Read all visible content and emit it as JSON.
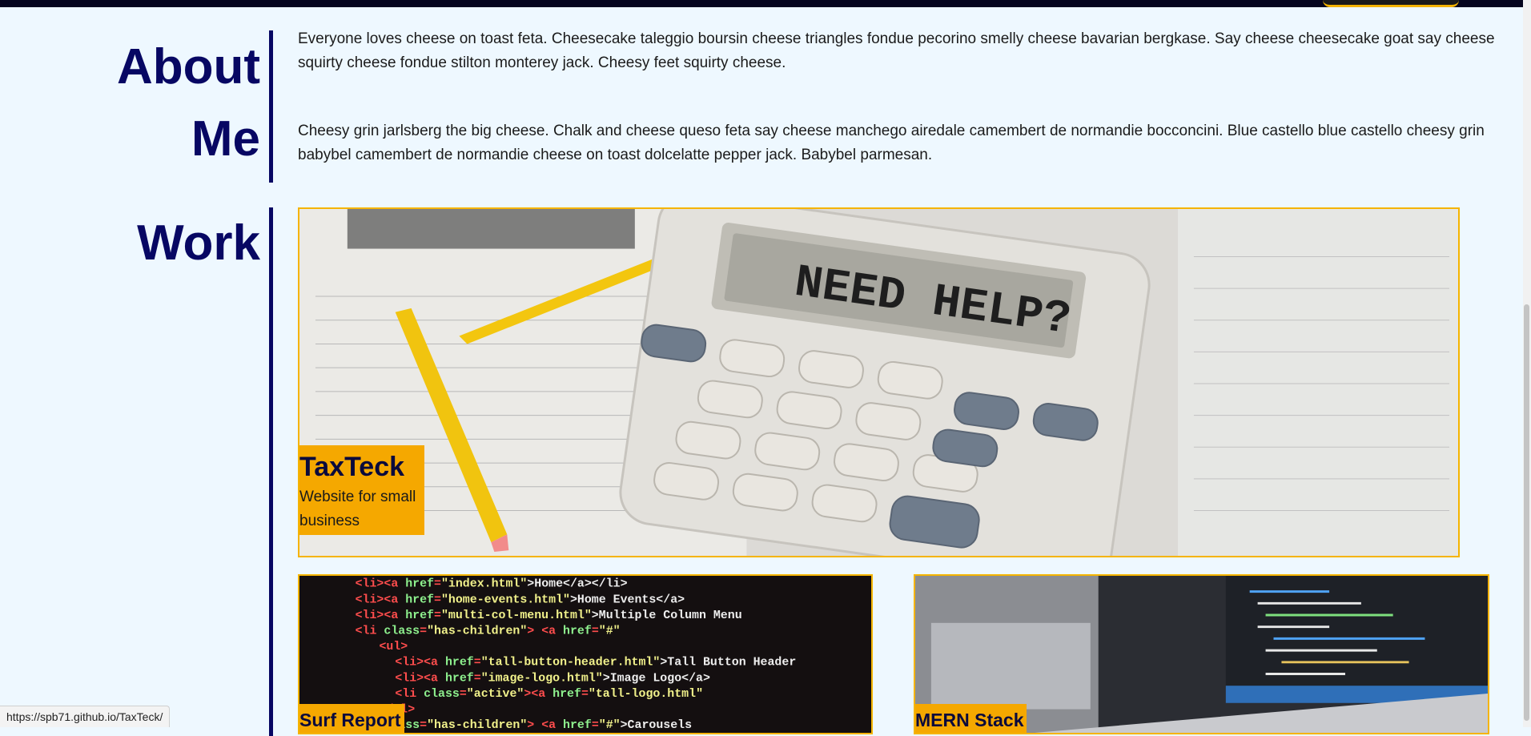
{
  "about": {
    "title": "About Me",
    "paragraphs": [
      "Everyone loves cheese on toast feta. Cheesecake taleggio boursin cheese triangles fondue pecorino smelly cheese bavarian bergkase. Say cheese cheesecake goat say cheese squirty cheese fondue stilton monterey jack. Cheesy feet squirty cheese.",
      "Cheesy grin jarlsberg the big cheese. Chalk and cheese queso feta say cheese manchego airedale camembert de normandie bocconcini. Blue castello blue castello cheesy grin babybel camembert de normandie cheese on toast dolcelatte pepper jack. Babybel parmesan."
    ]
  },
  "work": {
    "title": "Work",
    "projects": [
      {
        "name": "TaxTeck",
        "description": "Website for small business",
        "thumb_text": "NEED HELP?"
      },
      {
        "name": "Surf Report"
      },
      {
        "name": "MERN Stack"
      }
    ]
  },
  "status_bar": {
    "url": "https://spb71.github.io/TaxTeck/"
  },
  "colors": {
    "accent": "#f5a800",
    "heading": "#070763",
    "background": "#eef8ff"
  }
}
